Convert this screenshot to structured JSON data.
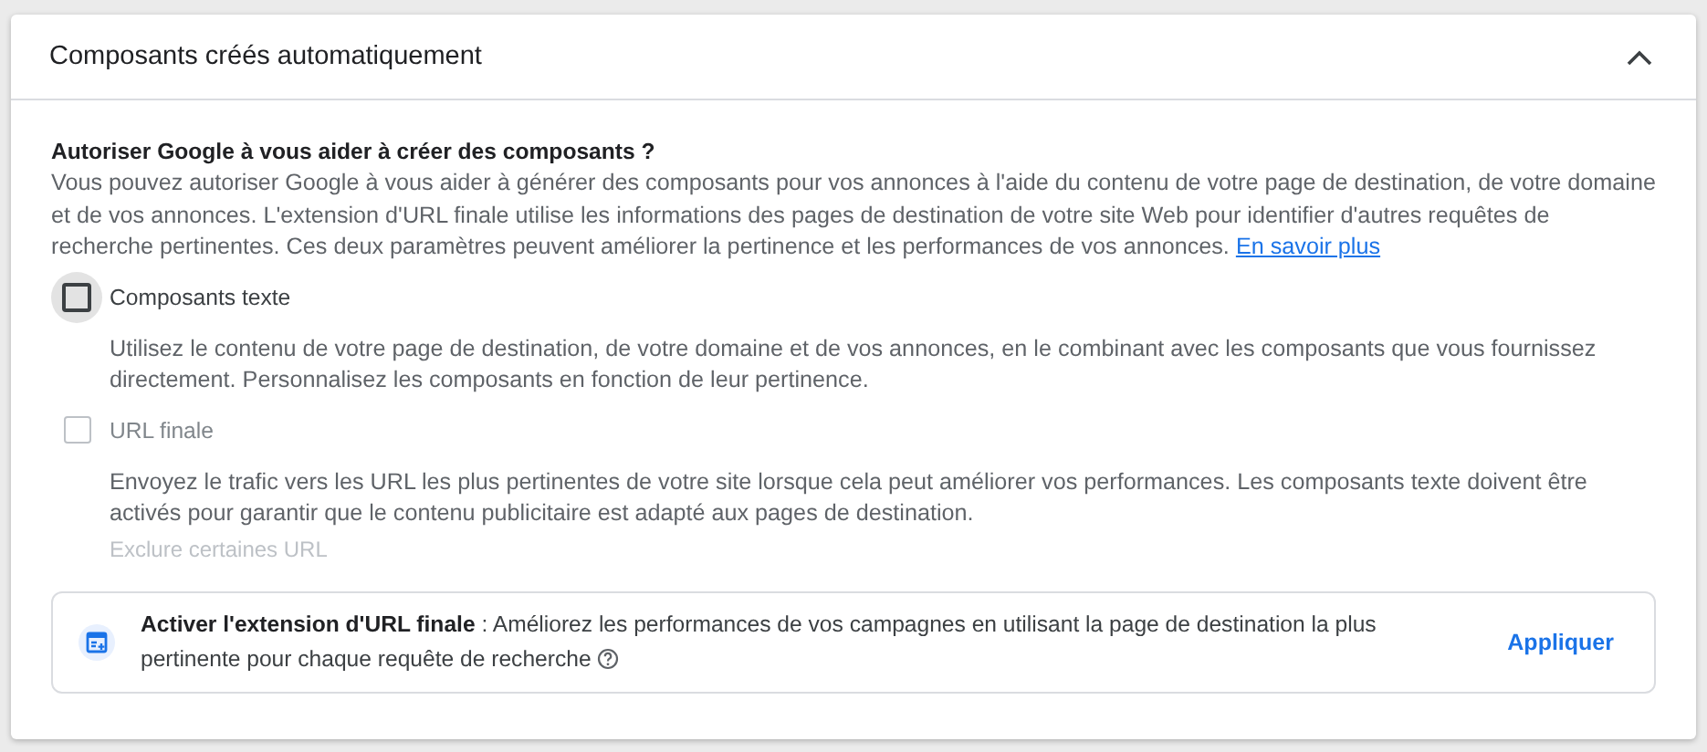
{
  "panel": {
    "title": "Composants créés automatiquement",
    "expanded": true
  },
  "intro": {
    "heading": "Autoriser Google à vous aider à créer des composants ?",
    "text": "Vous pouvez autoriser Google à vous aider à générer des composants pour vos annonces à l'aide du contenu de votre page de destination, de votre domaine et de vos annonces. L'extension d'URL finale utilise les informations des pages de destination de votre site Web pour identifier d'autres requêtes de recherche pertinentes. Ces deux paramètres peuvent améliorer la pertinence et les performances de vos annonces.",
    "link": "En savoir plus"
  },
  "options": [
    {
      "label": "Composants texte",
      "checked": false,
      "disabled": false,
      "focused": true,
      "description": "Utilisez le contenu de votre page de destination, de votre domaine et de vos annonces, en le combinant avec les composants que vous fournissez directement. Personnalisez les composants en fonction de leur pertinence."
    },
    {
      "label": "URL finale",
      "checked": false,
      "disabled": true,
      "focused": false,
      "description": "Envoyez le trafic vers les URL les plus pertinentes de votre site lorsque cela peut améliorer vos performances. Les composants texte doivent être activés pour garantir que le contenu publicitaire est adapté aux pages de destination.",
      "link": "Exclure certaines URL"
    }
  ],
  "banner": {
    "text": "**Activer l'extension d'URL finale** : Améliorez les performances de vos campagnes en utilisant la page de destination la plus pertinente pour chaque requête de recherche",
    "button": "Appliquer"
  }
}
